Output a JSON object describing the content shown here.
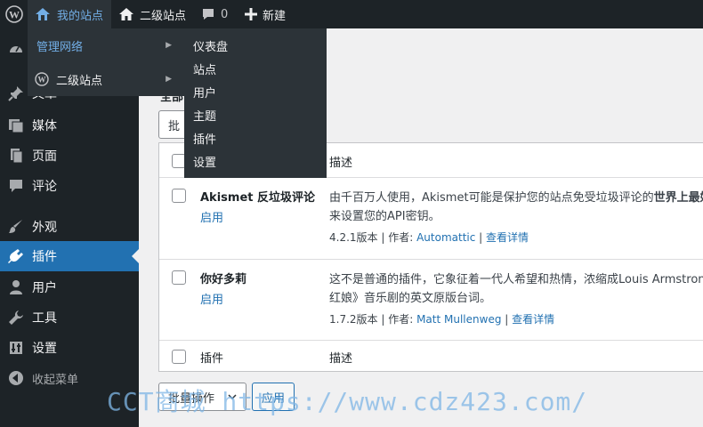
{
  "adminbar": {
    "my_sites": "我的站点",
    "site_name": "二级站点",
    "comments_count": "0",
    "new_label": "新建"
  },
  "flyout": {
    "network_admin": "管理网络",
    "subsite": "二级站点",
    "submenu": [
      "仪表盘",
      "站点",
      "用户",
      "主题",
      "插件",
      "设置"
    ]
  },
  "sidebar": {
    "items": [
      {
        "label": "文章",
        "icon": "pin-icon"
      },
      {
        "label": "媒体",
        "icon": "media-icon"
      },
      {
        "label": "页面",
        "icon": "page-icon"
      },
      {
        "label": "评论",
        "icon": "comment-icon"
      },
      {
        "label": "外观",
        "icon": "brush-icon"
      },
      {
        "label": "插件",
        "icon": "plugin-icon"
      },
      {
        "label": "用户",
        "icon": "user-icon"
      },
      {
        "label": "工具",
        "icon": "wrench-icon"
      },
      {
        "label": "设置",
        "icon": "settings-icon"
      },
      {
        "label": "收起菜单",
        "icon": "collapse-icon"
      }
    ]
  },
  "main": {
    "filter_partial": "全部",
    "bulk_top_partial": "批",
    "table": {
      "header_desc": "描述",
      "footer_plugin": "插件",
      "footer_desc": "描述",
      "rows": [
        {
          "name": "Akismet 反垃圾评论",
          "action": "启用",
          "desc_line1": "由千百万人使用，Akismet可能是保护您的站点免受垃圾评论的",
          "desc_bold": "世界上最好",
          "desc_line2": "来设置您的API密钥。",
          "version": "4.2.1版本",
          "sep1": " | ",
          "author_label": "作者: ",
          "author": "Automattic",
          "sep2": " | ",
          "details": "查看详情"
        },
        {
          "name": "你好多莉",
          "action": "启用",
          "desc_line1": "这不是普通的插件，它象征着一代人希望和热情，浓缩成Louis Armstrong",
          "desc_bold": "",
          "desc_line2": "红娘》音乐剧的英文原版台词。",
          "version": "1.7.2版本",
          "sep1": " | ",
          "author_label": "作者: ",
          "author": "Matt Mullenweg",
          "sep2": " | ",
          "details": "查看详情"
        }
      ]
    },
    "bulk_label": "批量操作",
    "apply_label": "应用"
  },
  "watermark": "CCT商城 https://www.cdz423.com/",
  "colors": {
    "bar": "#1d2327",
    "flyout": "#2c3338",
    "accent": "#2271b1",
    "highlight": "#72aee6"
  }
}
